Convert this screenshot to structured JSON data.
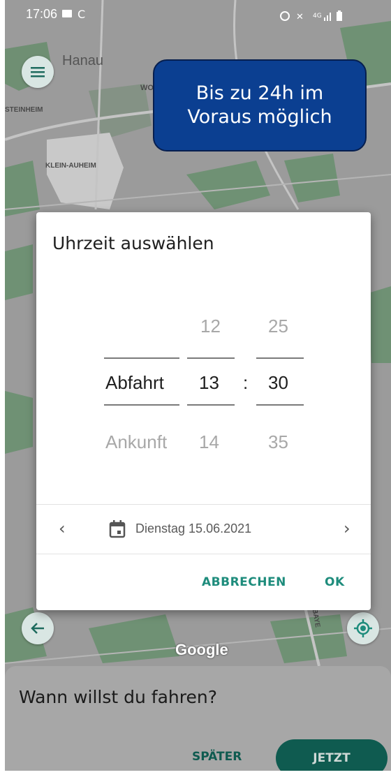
{
  "status_bar": {
    "time": "17:06",
    "icons": [
      "message-icon",
      "sync-icon",
      "alarm-icon",
      "mute-icon",
      "4g-icon",
      "signal-icon",
      "battery-icon"
    ]
  },
  "map": {
    "labels": {
      "hanau": "Hanau",
      "wo": "WO",
      "steinheim": "STEINHEIM",
      "klein_auheim": "KLEIN-AUHEIM",
      "baye": "BAYE"
    },
    "google_logo": "Google"
  },
  "promo_banner": {
    "line1": "Bis zu 24h im",
    "line2": "Voraus möglich",
    "color": "#0b3f91"
  },
  "dialog": {
    "title": "Uhrzeit auswählen",
    "mode_picker": {
      "selected": "Abfahrt",
      "below": "Ankunft"
    },
    "hour_picker": {
      "above": "12",
      "selected": "13",
      "below": "14"
    },
    "separator": ":",
    "minute_picker": {
      "above": "25",
      "selected": "30",
      "below": "35"
    },
    "date": "Dienstag 15.06.2021",
    "prev_label": "‹",
    "next_label": "›",
    "cancel_label": "ABBRECHEN",
    "ok_label": "OK",
    "accent": "#1e8c7c"
  },
  "bottom_sheet": {
    "title": "Wann willst du fahren?",
    "later_label": "SPÄTER",
    "now_label": "JETZT",
    "accent": "#0f5b50"
  }
}
